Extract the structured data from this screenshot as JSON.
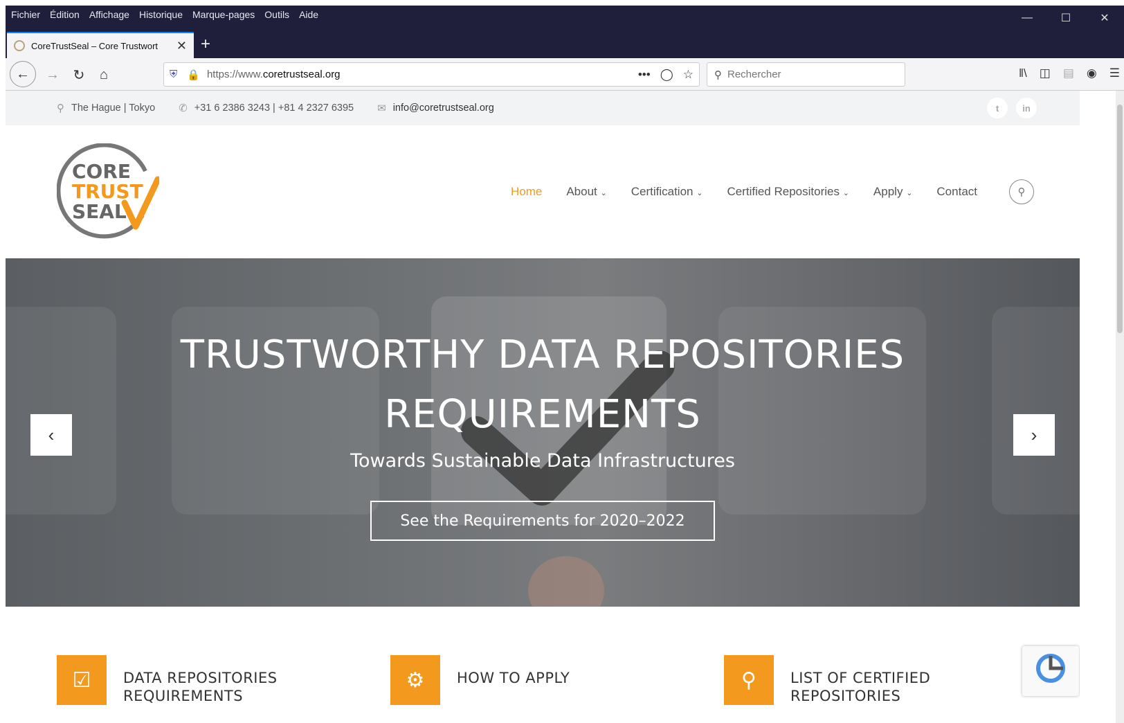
{
  "browser": {
    "menu": [
      "Fichier",
      "Édition",
      "Affichage",
      "Historique",
      "Marque-pages",
      "Outils",
      "Aide"
    ],
    "tab_title": "CoreTrustSeal – Core Trustwort",
    "url_prefix": "https://www.",
    "url_domain": "coretrustseal.org",
    "search_placeholder": "Rechercher"
  },
  "topinfo": {
    "location": "The Hague | Tokyo",
    "phone": "+31 6 2386 3243 | +81 4 2327 6395",
    "email": "info@coretrustseal.org",
    "social": [
      "twitter-icon",
      "linkedin-icon"
    ]
  },
  "logo": {
    "line1": "CORE",
    "line2": "TRUST",
    "line3": "SEAL"
  },
  "nav": {
    "items": [
      {
        "label": "Home",
        "active": true
      },
      {
        "label": "About",
        "dropdown": true
      },
      {
        "label": "Certification",
        "dropdown": true
      },
      {
        "label": "Certified Repositories",
        "dropdown": true
      },
      {
        "label": "Apply",
        "dropdown": true
      },
      {
        "label": "Contact"
      }
    ]
  },
  "hero": {
    "title_line1": "TRUSTWORTHY DATA REPOSITORIES",
    "title_line2": "REQUIREMENTS",
    "subtitle": "Towards Sustainable Data Infrastructures",
    "cta": "See the Requirements for 2020–2022"
  },
  "features": [
    {
      "icon": "checkbox-icon",
      "line1": "DATA REPOSITORIES",
      "line2": "REQUIREMENTS"
    },
    {
      "icon": "gears-icon",
      "line1": "HOW TO APPLY",
      "line2": ""
    },
    {
      "icon": "map-pin-icon",
      "line1": "LIST OF CERTIFIED",
      "line2": "REPOSITORIES"
    }
  ],
  "colors": {
    "accent": "#f39a1e",
    "titlebar": "#1f1e3b"
  }
}
